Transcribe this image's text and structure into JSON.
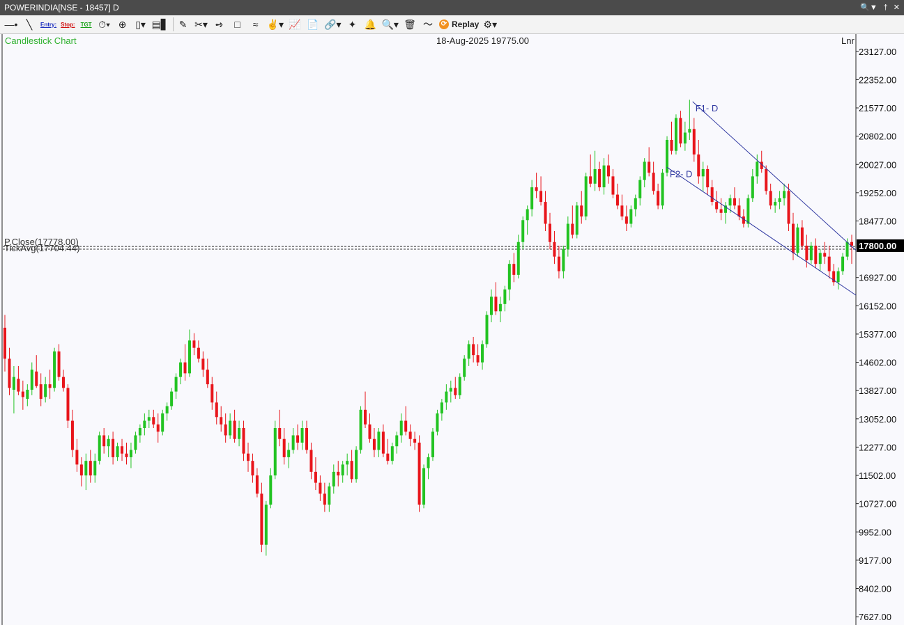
{
  "window": {
    "title": "POWERINDIA[NSE - 18457] D",
    "controls": [
      "search-user-icon",
      "pin-icon",
      "close-icon"
    ]
  },
  "toolbar": {
    "entry_label": "Entry:",
    "stop_label": "Stop:",
    "tgt_label": "TGT",
    "replay_label": "Replay"
  },
  "chart_header": {
    "chart_type_label": "Candlestick Chart",
    "date_value": "18-Aug-2025 19775.00",
    "scale_mode": "Lnr"
  },
  "colors": {
    "up": "#22c322",
    "down": "#e8151b",
    "trendline": "#2d36a0",
    "price_tag_bg": "#000000",
    "label_green": "#2fb02f"
  },
  "chart_data": {
    "type": "candlestick",
    "symbol": "POWERINDIA",
    "interval": "D",
    "ylim": [
      7400,
      23600
    ],
    "y_ticks": [
      23127,
      22352,
      21577,
      20802,
      20027,
      19252,
      18477,
      17800,
      16927,
      16152,
      15377,
      14602,
      13827,
      13052,
      12277,
      11502,
      10727,
      9952,
      9177,
      8402,
      7627
    ],
    "y_tick_labels": [
      "23127.00",
      "22352.00",
      "21577.00",
      "20802.00",
      "20027.00",
      "19252.00",
      "18477.00",
      "17800.00",
      "16927.00",
      "16152.00",
      "15377.00",
      "14602.00",
      "13827.00",
      "13052.00",
      "12277.00",
      "11502.00",
      "10727.00",
      "9952.00",
      "9177.00",
      "8402.00",
      "7627.00"
    ],
    "last_price": 17800,
    "last_price_label": "17800.00",
    "reference_lines": [
      {
        "name": "P.Close",
        "value": 17778,
        "label": "P.Close(17778.00)"
      },
      {
        "name": "TickAvg",
        "value": 17704.44,
        "label": "TickAvg(17704.44)"
      }
    ],
    "trendlines": [
      {
        "label": "F1- D",
        "start": [
          268,
          21750
        ],
        "end": [
          330,
          17780
        ]
      },
      {
        "label": "F2- D",
        "start": [
          258,
          19950
        ],
        "end": [
          330,
          16520
        ]
      }
    ],
    "candles_ohlc": [
      [
        15550,
        15900,
        14350,
        14700
      ],
      [
        14700,
        15000,
        13700,
        13900
      ],
      [
        13850,
        14500,
        13200,
        14200
      ],
      [
        14150,
        14500,
        13700,
        13800
      ],
      [
        13800,
        14100,
        13300,
        13650
      ],
      [
        13600,
        14000,
        13400,
        13850
      ],
      [
        13850,
        14600,
        13700,
        14400
      ],
      [
        14350,
        14800,
        13900,
        13950
      ],
      [
        14000,
        14300,
        13400,
        13600
      ],
      [
        13650,
        14200,
        13500,
        14000
      ],
      [
        14000,
        14400,
        13600,
        13900
      ],
      [
        13900,
        15000,
        13800,
        14900
      ],
      [
        14900,
        15100,
        14100,
        14200
      ],
      [
        14200,
        14400,
        13800,
        13900
      ],
      [
        13900,
        14000,
        12800,
        13000
      ],
      [
        13000,
        13300,
        12000,
        12200
      ],
      [
        12200,
        12500,
        11600,
        11800
      ],
      [
        11800,
        12000,
        11200,
        11500
      ],
      [
        11500,
        12100,
        11100,
        11900
      ],
      [
        11900,
        12200,
        11300,
        11500
      ],
      [
        11500,
        12100,
        11300,
        11900
      ],
      [
        11900,
        12700,
        11800,
        12600
      ],
      [
        12600,
        12800,
        12100,
        12300
      ],
      [
        12300,
        12600,
        12000,
        12500
      ],
      [
        12500,
        12700,
        11800,
        12000
      ],
      [
        12000,
        12400,
        11900,
        12300
      ],
      [
        12300,
        12500,
        11900,
        12100
      ],
      [
        12100,
        12400,
        11800,
        12000
      ],
      [
        12000,
        12400,
        11700,
        12200
      ],
      [
        12200,
        12700,
        12100,
        12600
      ],
      [
        12600,
        12900,
        12400,
        12800
      ],
      [
        12800,
        13200,
        12600,
        13000
      ],
      [
        13000,
        13300,
        12800,
        13100
      ],
      [
        13100,
        13300,
        12800,
        12900
      ],
      [
        12900,
        13200,
        12400,
        12700
      ],
      [
        12700,
        13300,
        12600,
        13200
      ],
      [
        13200,
        13500,
        13000,
        13400
      ],
      [
        13400,
        13900,
        13300,
        13800
      ],
      [
        13800,
        14300,
        13600,
        14200
      ],
      [
        14200,
        14700,
        14000,
        14600
      ],
      [
        14600,
        15100,
        14100,
        14300
      ],
      [
        14300,
        15500,
        14200,
        15200
      ],
      [
        15200,
        15400,
        14800,
        15000
      ],
      [
        15000,
        15200,
        14600,
        14700
      ],
      [
        14700,
        14900,
        14200,
        14400
      ],
      [
        14400,
        14700,
        13900,
        14000
      ],
      [
        14000,
        14200,
        13300,
        13500
      ],
      [
        13500,
        13800,
        12900,
        13100
      ],
      [
        13100,
        13400,
        12700,
        12900
      ],
      [
        12900,
        13200,
        12400,
        12600
      ],
      [
        12600,
        13200,
        12500,
        13000
      ],
      [
        13000,
        13300,
        12400,
        12500
      ],
      [
        12500,
        13000,
        12300,
        12800
      ],
      [
        12800,
        13000,
        11900,
        12100
      ],
      [
        12100,
        12400,
        11600,
        11900
      ],
      [
        11900,
        12100,
        11300,
        11500
      ],
      [
        11500,
        11700,
        10900,
        11000
      ],
      [
        11000,
        11300,
        9400,
        9600
      ],
      [
        9600,
        10800,
        9300,
        10700
      ],
      [
        10700,
        11700,
        10600,
        11500
      ],
      [
        11500,
        13000,
        11400,
        12800
      ],
      [
        12800,
        13300,
        12300,
        12500
      ],
      [
        12500,
        12800,
        11800,
        12000
      ],
      [
        12000,
        12400,
        11700,
        12200
      ],
      [
        12200,
        12800,
        12100,
        12600
      ],
      [
        12600,
        12900,
        12200,
        12400
      ],
      [
        12400,
        13000,
        12200,
        12800
      ],
      [
        12800,
        13000,
        12100,
        12200
      ],
      [
        12200,
        12400,
        11400,
        11600
      ],
      [
        11600,
        12000,
        11100,
        11300
      ],
      [
        11300,
        11500,
        10800,
        11000
      ],
      [
        11000,
        11300,
        10500,
        10700
      ],
      [
        10700,
        11300,
        10500,
        11200
      ],
      [
        11200,
        11800,
        11000,
        11600
      ],
      [
        11600,
        11900,
        11200,
        11500
      ],
      [
        11500,
        11900,
        11300,
        11800
      ],
      [
        11800,
        12100,
        11500,
        11900
      ],
      [
        11900,
        12200,
        11300,
        11400
      ],
      [
        11400,
        12300,
        11300,
        12200
      ],
      [
        12200,
        13400,
        12100,
        13300
      ],
      [
        13300,
        13800,
        12800,
        12900
      ],
      [
        12900,
        13200,
        12400,
        12500
      ],
      [
        12500,
        12800,
        12000,
        12200
      ],
      [
        12200,
        12800,
        12000,
        12700
      ],
      [
        12700,
        12900,
        12000,
        12100
      ],
      [
        12100,
        12500,
        11800,
        11900
      ],
      [
        11900,
        12400,
        11800,
        12300
      ],
      [
        12300,
        12700,
        12100,
        12600
      ],
      [
        12600,
        13200,
        12400,
        13000
      ],
      [
        13000,
        13400,
        12600,
        12700
      ],
      [
        12700,
        12900,
        12300,
        12500
      ],
      [
        12500,
        12700,
        12200,
        12400
      ],
      [
        12400,
        12600,
        10500,
        10700
      ],
      [
        10700,
        11800,
        10600,
        11700
      ],
      [
        11700,
        12100,
        11400,
        12000
      ],
      [
        12000,
        12800,
        11900,
        12700
      ],
      [
        12700,
        13300,
        12600,
        13200
      ],
      [
        13200,
        13600,
        13000,
        13500
      ],
      [
        13500,
        14000,
        13300,
        13800
      ],
      [
        13800,
        14100,
        13500,
        13900
      ],
      [
        13900,
        14200,
        13600,
        13700
      ],
      [
        13700,
        14300,
        13600,
        14200
      ],
      [
        14200,
        14800,
        14100,
        14700
      ],
      [
        14700,
        15200,
        14500,
        15100
      ],
      [
        15100,
        15300,
        14600,
        14800
      ],
      [
        14800,
        15100,
        14500,
        14600
      ],
      [
        14600,
        15200,
        14400,
        15100
      ],
      [
        15100,
        16000,
        15000,
        15900
      ],
      [
        15900,
        16600,
        15700,
        16400
      ],
      [
        16400,
        16800,
        15900,
        16000
      ],
      [
        16000,
        16400,
        15700,
        16200
      ],
      [
        16200,
        16700,
        16000,
        16600
      ],
      [
        16600,
        17400,
        16300,
        17300
      ],
      [
        17300,
        17600,
        16800,
        17000
      ],
      [
        17000,
        18100,
        16900,
        17900
      ],
      [
        17900,
        18600,
        17700,
        18500
      ],
      [
        18500,
        18900,
        18100,
        18800
      ],
      [
        18800,
        19600,
        18600,
        19400
      ],
      [
        19400,
        19800,
        19100,
        19300
      ],
      [
        19300,
        19700,
        18900,
        19000
      ],
      [
        19000,
        19300,
        18200,
        18400
      ],
      [
        18400,
        18700,
        17700,
        17900
      ],
      [
        17900,
        18200,
        17300,
        17500
      ],
      [
        17500,
        17800,
        16900,
        17100
      ],
      [
        17100,
        17800,
        16900,
        17700
      ],
      [
        17700,
        18600,
        17500,
        18400
      ],
      [
        18400,
        18900,
        18000,
        18100
      ],
      [
        18100,
        19000,
        18000,
        18900
      ],
      [
        18900,
        19300,
        18400,
        18600
      ],
      [
        18600,
        19800,
        18500,
        19700
      ],
      [
        19700,
        20300,
        19400,
        19500
      ],
      [
        19500,
        20400,
        19300,
        19900
      ],
      [
        19900,
        20100,
        19300,
        19400
      ],
      [
        19400,
        20200,
        19200,
        20000
      ],
      [
        20000,
        20300,
        19500,
        19700
      ],
      [
        19700,
        19900,
        19100,
        19200
      ],
      [
        19200,
        19500,
        18800,
        18900
      ],
      [
        18900,
        19200,
        18500,
        18600
      ],
      [
        18600,
        18900,
        18200,
        18400
      ],
      [
        18400,
        18900,
        18300,
        18800
      ],
      [
        18800,
        19200,
        18600,
        19100
      ],
      [
        19100,
        19700,
        18900,
        19600
      ],
      [
        19600,
        20200,
        19400,
        20100
      ],
      [
        20100,
        20500,
        19700,
        19800
      ],
      [
        19800,
        20100,
        19200,
        19300
      ],
      [
        19300,
        19500,
        18800,
        18900
      ],
      [
        18900,
        19900,
        18800,
        19800
      ],
      [
        19800,
        20800,
        19700,
        20700
      ],
      [
        20700,
        21200,
        20300,
        20400
      ],
      [
        20400,
        21400,
        20300,
        21300
      ],
      [
        21300,
        21500,
        20500,
        20600
      ],
      [
        20600,
        21200,
        20400,
        20900
      ],
      [
        20900,
        21800,
        20700,
        21000
      ],
      [
        21000,
        21300,
        20100,
        20300
      ],
      [
        20300,
        20700,
        19500,
        19700
      ],
      [
        19700,
        20100,
        19300,
        19900
      ],
      [
        19900,
        20000,
        19200,
        19400
      ],
      [
        19400,
        19600,
        18900,
        19000
      ],
      [
        19000,
        19300,
        18700,
        18800
      ],
      [
        18800,
        19100,
        18500,
        18700
      ],
      [
        18700,
        19000,
        18400,
        18900
      ],
      [
        18900,
        19200,
        18700,
        19100
      ],
      [
        19100,
        19400,
        18800,
        18900
      ],
      [
        18900,
        19100,
        18500,
        18600
      ],
      [
        18600,
        18800,
        18300,
        18400
      ],
      [
        18400,
        19200,
        18300,
        19100
      ],
      [
        19100,
        19900,
        19000,
        19700
      ],
      [
        19700,
        20300,
        19500,
        20100
      ],
      [
        20100,
        20400,
        19800,
        19900
      ],
      [
        19900,
        20000,
        19200,
        19300
      ],
      [
        19300,
        19500,
        18800,
        18900
      ],
      [
        18900,
        19100,
        18700,
        19000
      ],
      [
        19000,
        19300,
        18800,
        19100
      ],
      [
        19100,
        19500,
        18900,
        19300
      ],
      [
        19300,
        19500,
        18200,
        18400
      ],
      [
        18400,
        18700,
        17400,
        17600
      ],
      [
        17600,
        18400,
        17500,
        18300
      ],
      [
        18300,
        18500,
        17700,
        17800
      ],
      [
        17800,
        18100,
        17200,
        17400
      ],
      [
        17400,
        17900,
        17300,
        17800
      ],
      [
        17800,
        18000,
        17200,
        17300
      ],
      [
        17300,
        17700,
        17100,
        17600
      ],
      [
        17600,
        17900,
        17300,
        17500
      ],
      [
        17500,
        17800,
        16900,
        17100
      ],
      [
        17100,
        17300,
        16700,
        16800
      ],
      [
        16800,
        17200,
        16600,
        17100
      ],
      [
        17100,
        17600,
        17000,
        17500
      ],
      [
        17500,
        18000,
        17400,
        17900
      ],
      [
        17900,
        18100,
        17300,
        17800
      ]
    ]
  }
}
